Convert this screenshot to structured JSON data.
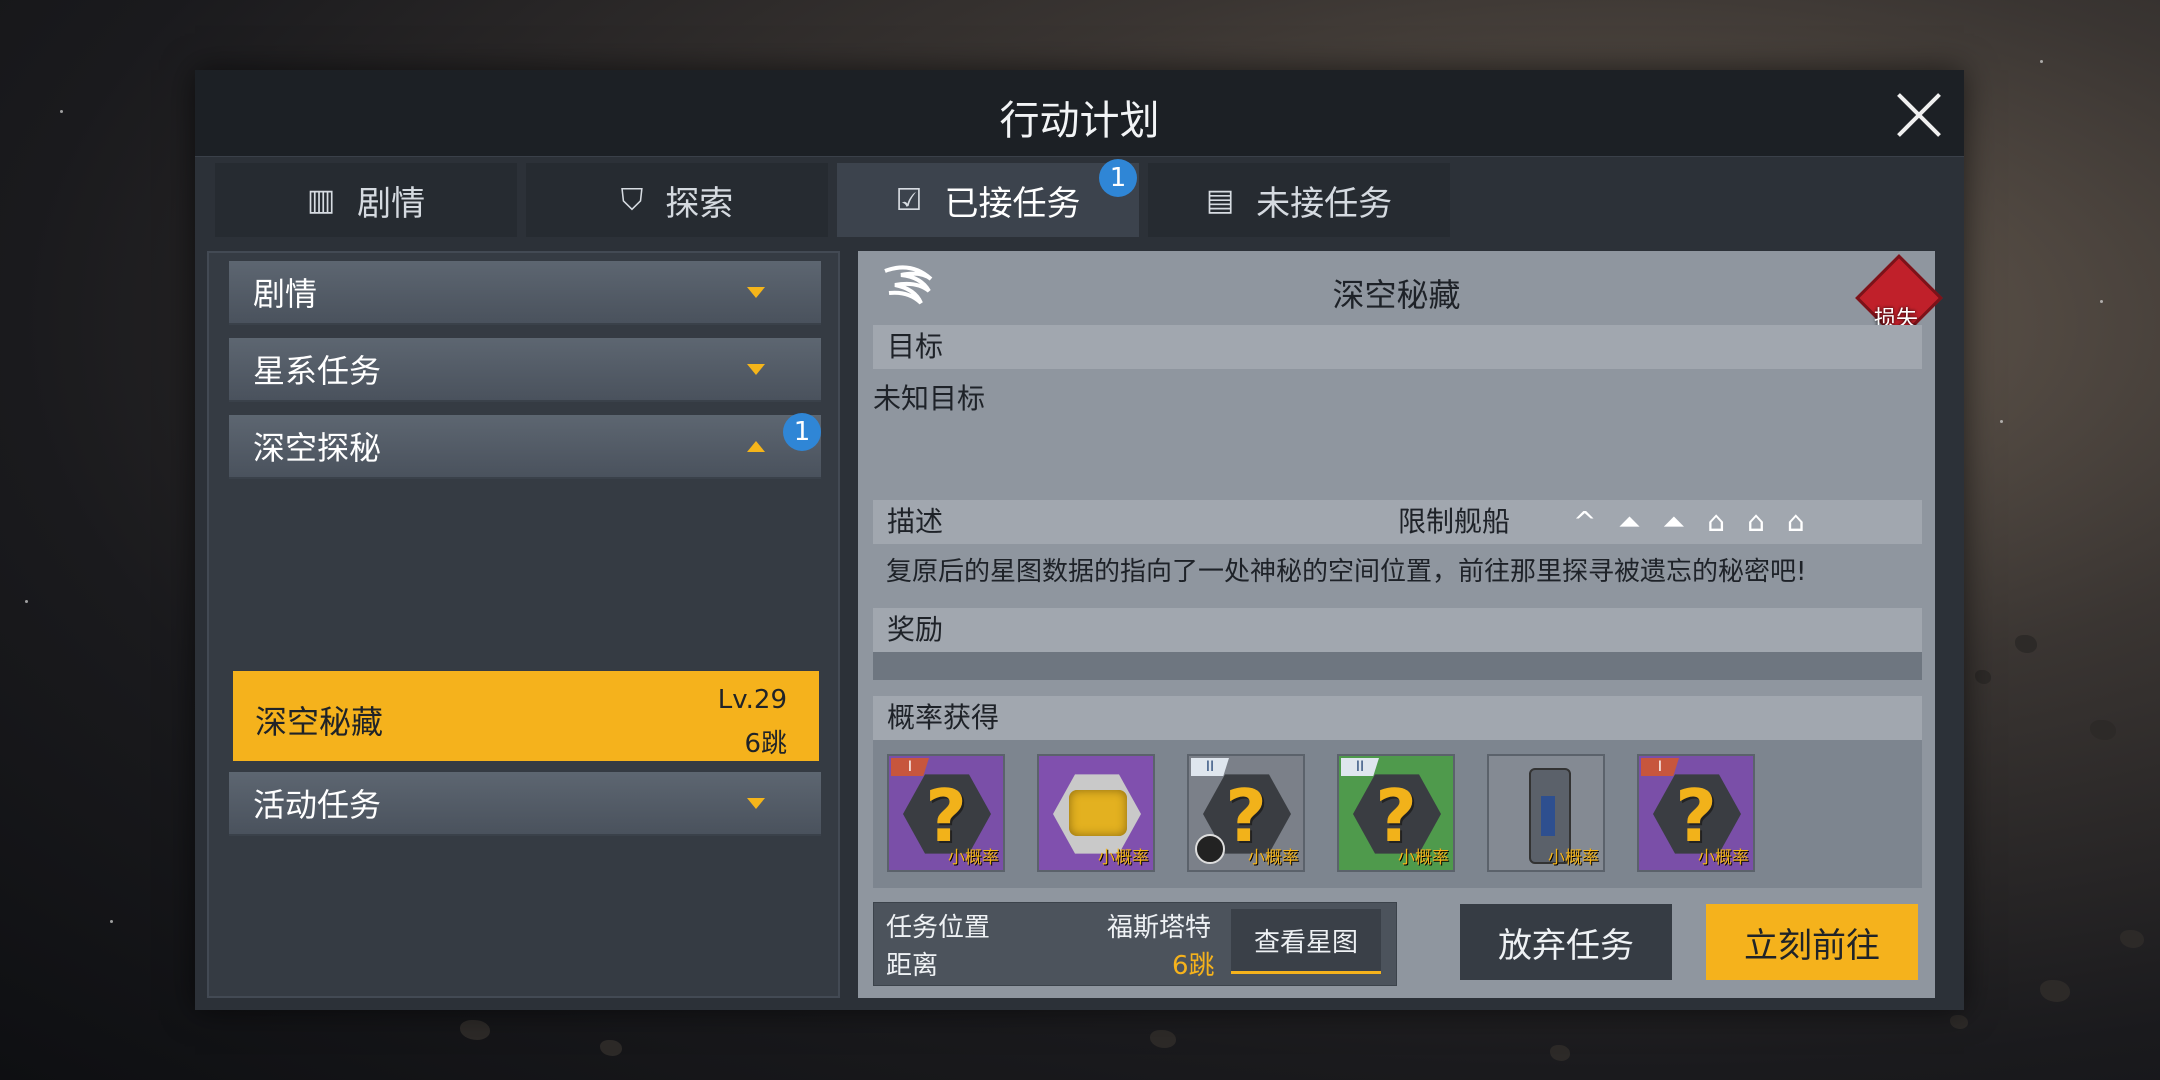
{
  "window": {
    "title": "行动计划"
  },
  "tabs": [
    {
      "label": "剧情",
      "icon": "book-icon"
    },
    {
      "label": "探索",
      "icon": "explore-icon"
    },
    {
      "label": "已接任务",
      "icon": "accepted-task-icon",
      "badge": "1"
    },
    {
      "label": "未接任务",
      "icon": "pending-task-icon"
    }
  ],
  "categories": [
    {
      "label": "剧情",
      "expanded": false
    },
    {
      "label": "星系任务",
      "expanded": false
    },
    {
      "label": "深空探秘",
      "expanded": true,
      "badge": "1"
    },
    {
      "label": "活动任务",
      "expanded": false
    }
  ],
  "selected_mission": {
    "name": "深空秘藏",
    "level": "Lv.29",
    "jumps": "6跳"
  },
  "detail": {
    "name": "深空秘藏",
    "loss_label": "损失",
    "goal_header": "目标",
    "goal_text": "未知目标",
    "desc_header": "描述",
    "ship_limit_label": "限制舰船",
    "ship_icons": [
      "^",
      "⏶",
      "⏶",
      "⌂",
      "⌂",
      "⌂"
    ],
    "desc_text": "复原后的星图数据的指向了一处神秘的空间位置，前往那里探寻被遗忘的秘密吧!",
    "reward_header": "奖励",
    "chance_header": "概率获得",
    "items": [
      {
        "rank": "I",
        "tag": "小概率",
        "bg": "#7a4fa8",
        "kind": "unknown"
      },
      {
        "rank": "",
        "tag": "小概率",
        "bg": "#8050ae",
        "kind": "gold"
      },
      {
        "rank": "II",
        "tag": "小概率",
        "bg": "#7b8089",
        "kind": "unknown"
      },
      {
        "rank": "II",
        "tag": "小概率",
        "bg": "#4f9a4c",
        "kind": "unknown"
      },
      {
        "rank": "",
        "tag": "小概率",
        "bg": "#848a93",
        "kind": "canister"
      },
      {
        "rank": "I",
        "tag": "小概率",
        "bg": "#7a4fa8",
        "kind": "unknown"
      }
    ],
    "location_label": "任务位置",
    "location_value": "福斯塔特",
    "distance_label": "距离",
    "distance_value": "6跳",
    "view_map_button": "查看星图",
    "abandon_button": "放弃任务",
    "go_button": "立刻前往"
  },
  "colors": {
    "accent": "#f5b21c",
    "badge": "#2f86d6",
    "loss": "#c0202a"
  }
}
